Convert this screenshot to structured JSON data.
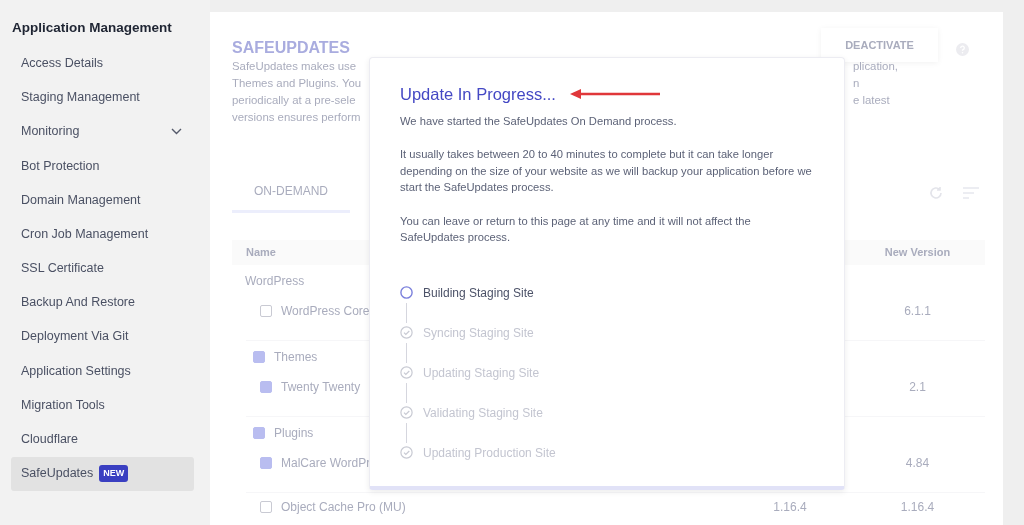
{
  "sidebar": {
    "title": "Application Management",
    "items": [
      {
        "label": "Access Details",
        "selected": false
      },
      {
        "label": "Staging Management",
        "selected": false
      },
      {
        "label": "Monitoring",
        "selected": false,
        "expandable": true
      },
      {
        "label": "Bot Protection",
        "selected": false
      },
      {
        "label": "Domain Management",
        "selected": false
      },
      {
        "label": "Cron Job Management",
        "selected": false
      },
      {
        "label": "SSL Certificate",
        "selected": false
      },
      {
        "label": "Backup And Restore",
        "selected": false
      },
      {
        "label": "Deployment Via Git",
        "selected": false
      },
      {
        "label": "Application Settings",
        "selected": false
      },
      {
        "label": "Migration Tools",
        "selected": false
      },
      {
        "label": "Cloudflare",
        "selected": false
      },
      {
        "label": "SafeUpdates",
        "selected": true,
        "badge": "NEW"
      }
    ]
  },
  "page": {
    "title": "SAFEUPDATES",
    "deactivate_button": "DEACTIVATE",
    "description_lines": [
      {
        "left": "SafeUpdates makes use",
        "right": "plication,"
      },
      {
        "left": "Themes and Plugins. You",
        "right": "n"
      },
      {
        "left": "periodically at a pre-sele",
        "right": "e latest"
      },
      {
        "left": "versions ensures perform"
      }
    ],
    "tabs": [
      {
        "label": "ON-DEMAND",
        "selected": true
      }
    ],
    "table": {
      "columns": [
        "Name",
        "New Version"
      ],
      "rows": [
        {
          "kind": "section",
          "label": "WordPress"
        },
        {
          "kind": "item",
          "label": "WordPress Core",
          "checked": false,
          "new_version": "6.1.1"
        },
        {
          "kind": "group",
          "label": "Themes",
          "checked": true
        },
        {
          "kind": "item",
          "label": "Twenty Twenty",
          "checked": true,
          "new_version": "2.1"
        },
        {
          "kind": "group",
          "label": "Plugins",
          "checked": true
        },
        {
          "kind": "item",
          "label": "MalCare WordPr",
          "checked": true,
          "new_version": "4.84"
        },
        {
          "kind": "item",
          "label": "Object Cache Pro (MU)",
          "checked": false,
          "current_version": "1.16.4",
          "new_version": "1.16.4"
        }
      ]
    }
  },
  "modal": {
    "title": "Update In Progress...",
    "paragraphs": [
      "We have started the SafeUpdates On Demand process.",
      "It usually takes between 20 to 40 minutes to complete but it can take longer depending on the size of your website as we will backup your application before we start the SafeUpdates process.",
      "You can leave or return to this page at any time and it will not affect the SafeUpdates process."
    ],
    "steps": [
      {
        "label": "Building Staging Site",
        "active": true
      },
      {
        "label": "Syncing Staging Site",
        "active": false
      },
      {
        "label": "Updating Staging Site",
        "active": false
      },
      {
        "label": "Validating Staging Site",
        "active": false
      },
      {
        "label": "Updating Production Site",
        "active": false
      }
    ]
  }
}
